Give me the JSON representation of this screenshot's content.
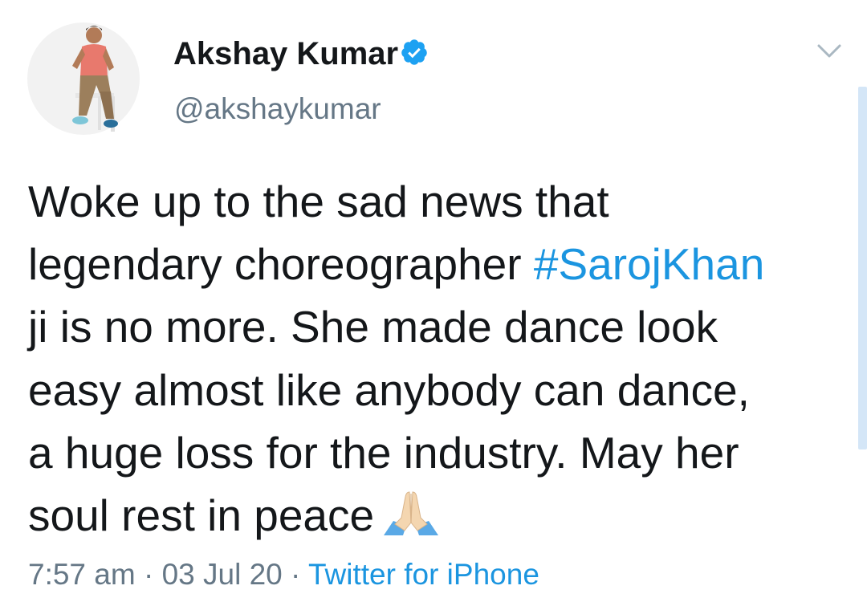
{
  "author": {
    "name": "Akshay Kumar",
    "handle": "@akshaykumar",
    "verified": true
  },
  "tweet": {
    "lines": [
      "Woke up to the sad news that",
      "legendary choreographer ",
      "ji is no more. She made dance look",
      "easy almost like anybody can dance,",
      "a huge loss for the industry. May her",
      "soul rest in peace"
    ],
    "hashtag": "#SarojKhan",
    "emoji": "folded-hands"
  },
  "meta": {
    "time": "7:57 am",
    "separator": " · ",
    "date": "03 Jul 20",
    "source": "Twitter for iPhone"
  },
  "icons": {
    "menu": "chevron-down-icon",
    "verified": "verified-badge-icon"
  },
  "colors": {
    "text": "#14171a",
    "secondary": "#657786",
    "link": "#1b95e0",
    "verified": "#1da1f2"
  }
}
